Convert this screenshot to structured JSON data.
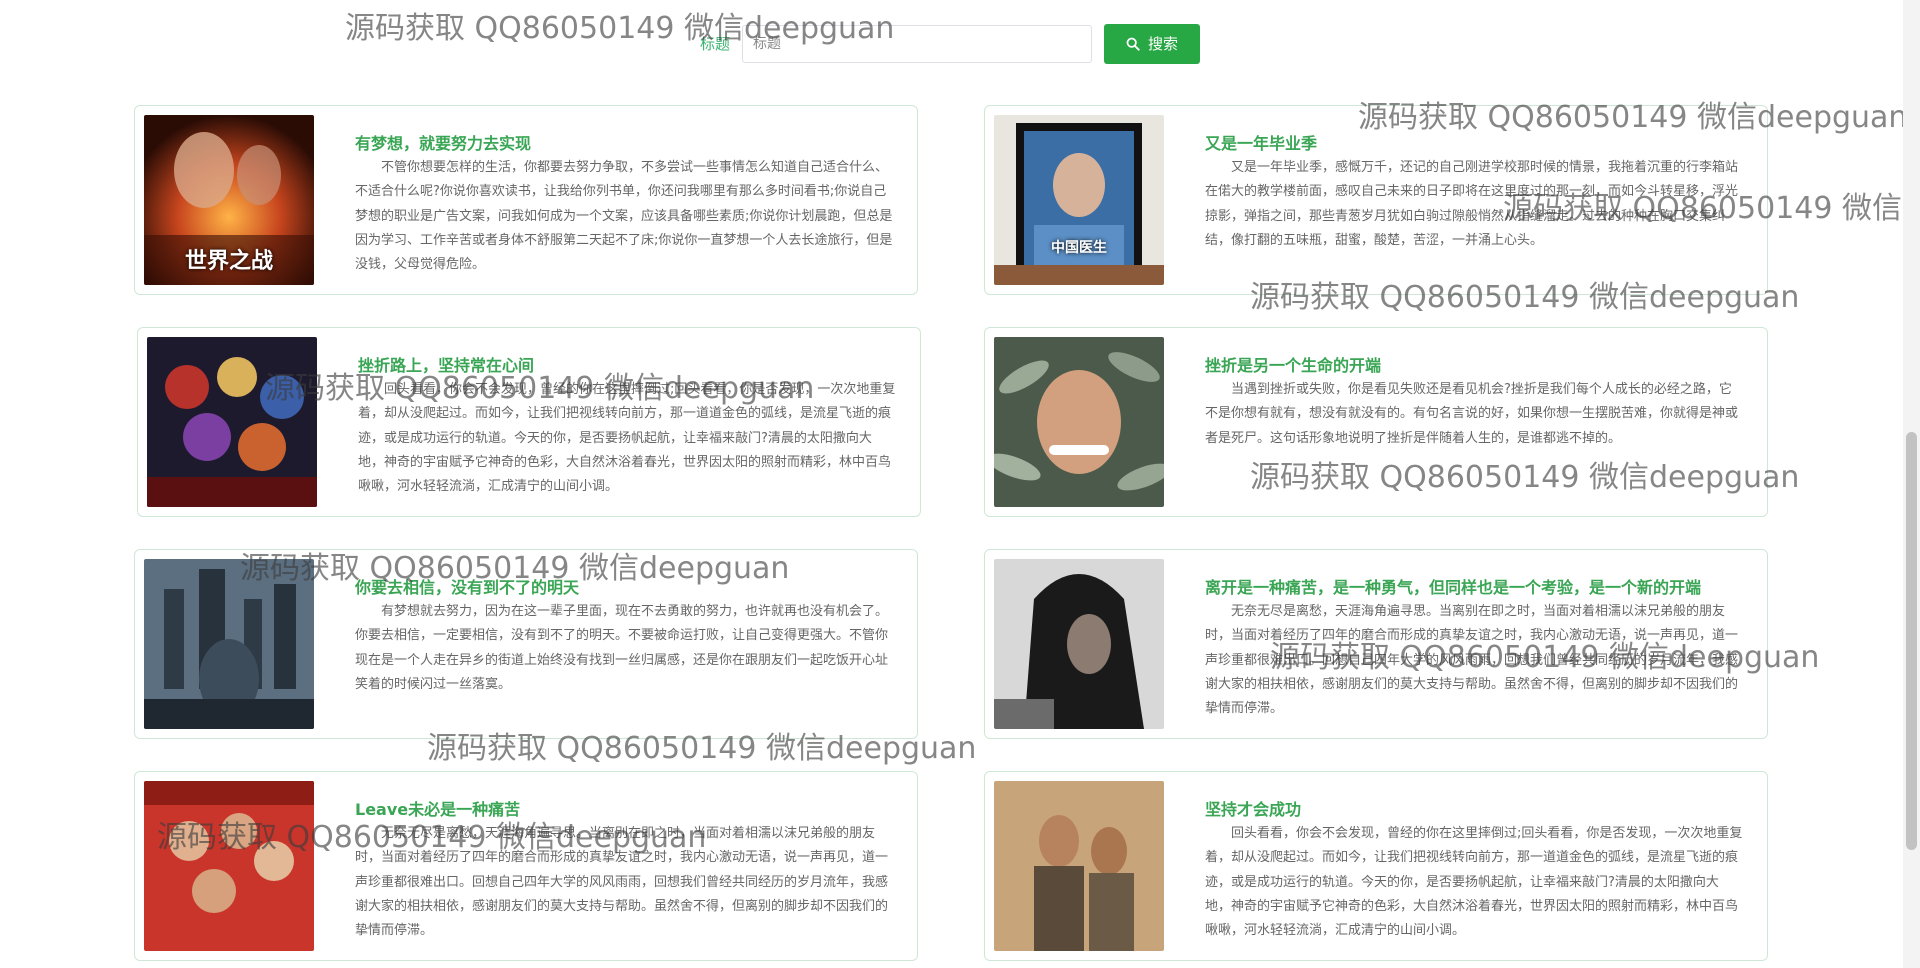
{
  "search": {
    "label": "标题",
    "placeholder": "标题",
    "button_label": "搜索"
  },
  "articles": [
    {
      "title": "有梦想，就要努力去实现",
      "poster_caption": "世界之战",
      "text": "不管你想要怎样的生活，你都要去努力争取，不多尝试一些事情怎么知道自己适合什么、不适合什么呢?你说你喜欢读书，让我给你列书单，你还问我哪里有那么多时间看书;你说自己梦想的职业是广告文案，问我如何成为一个文案，应该具备哪些素质;你说你计划晨跑，但总是因为学习、工作辛苦或者身体不舒服第二天起不了床;你说你一直梦想一个人去长途旅行，但是没钱，父母觉得危险。"
    },
    {
      "title": "又是一年毕业季",
      "poster_caption": "中国医生",
      "text": "又是一年毕业季，感慨万千，还记的自己刚进学校那时候的情景，我拖着沉重的行李箱站在偌大的教学楼前面，感叹自己未来的日子即将在这里度过的那一刻，而如今斗转星移，浮光掠影，弹指之间，那些青葱岁月犹如白驹过隙般悄然从指缝溜走。过去的种种在胸口交集纠结，像打翻的五味瓶，甜蜜，酸楚，苦涩，一并涌上心头。"
    },
    {
      "title": "挫折路上，坚持常在心间",
      "poster_caption": "",
      "text": "回头看看，你会不会发现，曾经的你在这里摔倒过;回头看看，你是否发现，一次次地重复着，却从没爬起过。而如今，让我们把视线转向前方，那一道道金色的弧线，是流星飞逝的痕迹，或是成功运行的轨道。今天的你，是否要扬帆起航，让幸福来敲门?清晨的太阳撒向大地，神奇的宇宙赋予它神奇的色彩，大自然沐浴着春光，世界因太阳的照射而精彩，林中百鸟啾啾，河水轻轻流淌，汇成清宁的山间小调。"
    },
    {
      "title": "挫折是另一个生命的开端",
      "poster_caption": "",
      "text": "当遇到挫折或失败，你是看见失败还是看见机会?挫折是我们每个人成长的必经之路，它不是你想有就有，想没有就没有的。有句名言说的好，如果你想一生摆脱苦难，你就得是神或者是死尸。这句话形象地说明了挫折是伴随着人生的，是谁都逃不掉的。"
    },
    {
      "title": "你要去相信，没有到不了的明天",
      "poster_caption": "",
      "text": "有梦想就去努力，因为在这一辈子里面，现在不去勇敢的努力，也许就再也没有机会了。你要去相信，一定要相信，没有到不了的明天。不要被命运打败，让自己变得更强大。不管你现在是一个人走在异乡的街道上始终没有找到一丝归属感，还是你在跟朋友们一起吃饭开心址笑着的时候闪过一丝落寞。"
    },
    {
      "title": "离开是一种痛苦，是一种勇气，但同样也是一个考验，是一个新的开端",
      "poster_caption": "",
      "text": "无奈无尽是离愁，天涯海角遍寻思。当离别在即之时，当面对着相濡以沫兄弟般的朋友时，当面对着经历了四年的磨合而形成的真挚友谊之时，我内心激动无语，说一声再见，道一声珍重都很难出口。回想自己四年大学的风风雨雨，回想我们曾经共同经历的岁月流年，我感谢大家的相扶相依，感谢朋友们的莫大支持与帮助。虽然舍不得，但离别的脚步却不因我们的挚情而停滞。"
    },
    {
      "title": "Leave未必是一种痛苦",
      "poster_caption": "",
      "text": "无奈无尽是离愁，天涯海角遍寻思。当离别在即之时，当面对着相濡以沫兄弟般的朋友时，当面对着经历了四年的磨合而形成的真挚友谊之时，我内心激动无语，说一声再见，道一声珍重都很难出口。回想自己四年大学的风风雨雨，回想我们曾经共同经历的岁月流年，我感谢大家的相扶相依，感谢朋友们的莫大支持与帮助。虽然舍不得，但离别的脚步却不因我们的挚情而停滞。"
    },
    {
      "title": "坚持才会成功",
      "poster_caption": "",
      "text": "回头看看，你会不会发现，曾经的你在这里摔倒过;回头看看，你是否发现，一次次地重复着，却从没爬起过。而如今，让我们把视线转向前方，那一道道金色的弧线，是流星飞逝的痕迹，或是成功运行的轨道。今天的你，是否要扬帆起航，让幸福来敲门?清晨的太阳撒向大地，神奇的宇宙赋予它神奇的色彩，大自然沐浴着春光，世界因太阳的照射而精彩，林中百鸟啾啾，河水轻轻流淌，汇成清宁的山间小调。"
    }
  ],
  "watermark_text": "源码获取 QQ86050149 微信deepguan",
  "colors": {
    "accent_green": "#28a745",
    "title_green": "#3aa655",
    "card_border": "#cfe8d6"
  }
}
